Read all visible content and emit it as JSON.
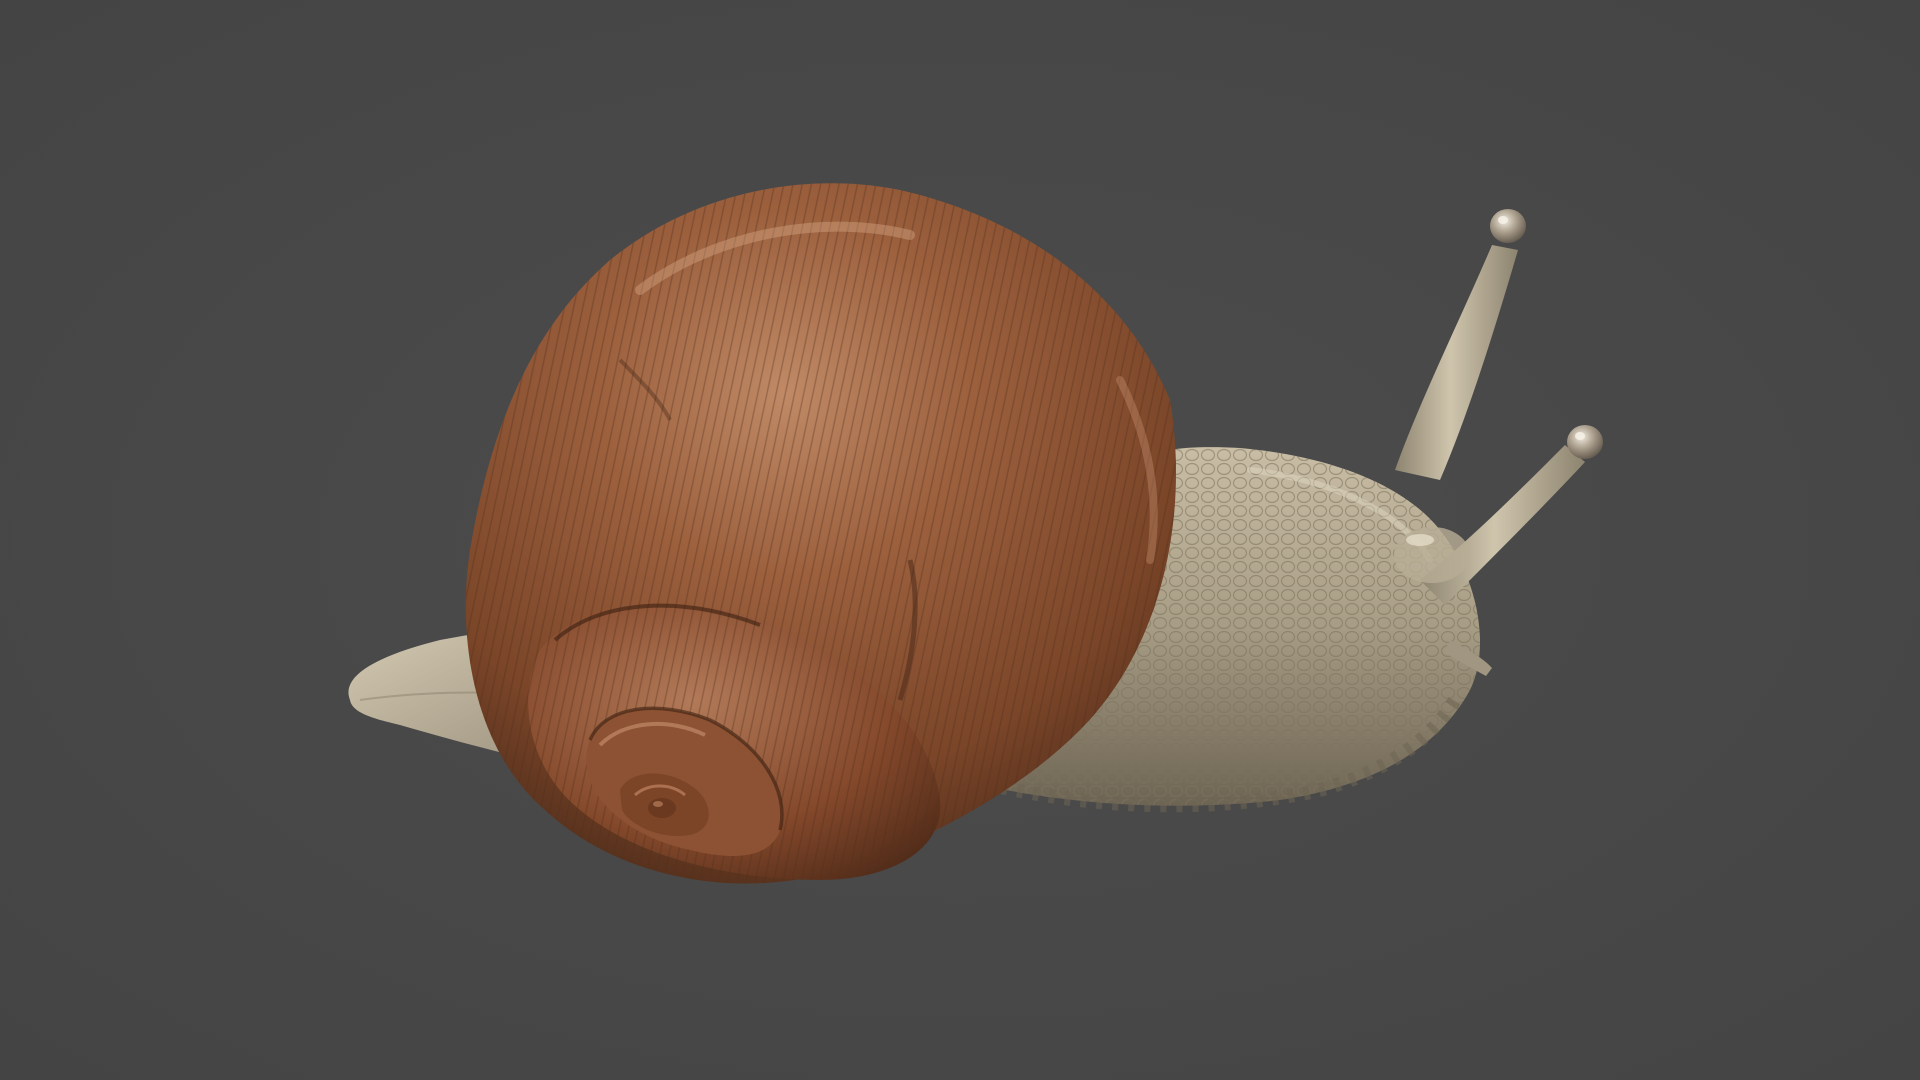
{
  "scene": {
    "background_color": "#484848",
    "subject": "snail-3d-model",
    "colors": {
      "shell_base": "#8a5434",
      "shell_highlight": "#c08a66",
      "shell_shadow": "#4e2c1a",
      "body_base": "#a79c84",
      "body_highlight": "#d6ccb5",
      "body_shadow": "#6d6453"
    }
  }
}
